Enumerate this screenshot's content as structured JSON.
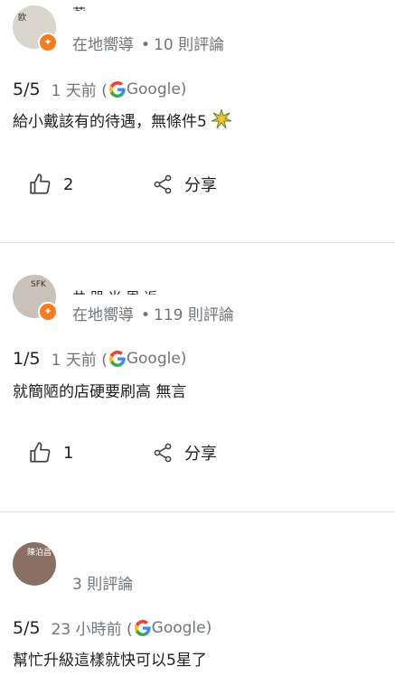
{
  "reviews": [
    {
      "avatar_text": "欧",
      "name": "莉",
      "meta": {
        "guide": "在地嚮導",
        "count": "10 則評論"
      },
      "rating": "5/5",
      "time": "1 天前 (",
      "source": "Google)",
      "text": "給小戴該有的待遇，無條件5",
      "emoji": "sparkle",
      "likes": "2",
      "share": "分享"
    },
    {
      "avatar_text": "SFK",
      "name": "井 咒 米 周 返",
      "meta": {
        "guide": "在地嚮導",
        "count": "119 則評論"
      },
      "rating": "1/5",
      "time": "1 天前 (",
      "source": "Google)",
      "text": "就簡陋的店硬要刷高 無言",
      "likes": "1",
      "share": "分享"
    },
    {
      "avatar_text": "陳泊昌",
      "meta": {
        "count": "3 則評論"
      },
      "rating": "5/5",
      "time": "23 小時前 (",
      "source": "Google)",
      "text": "幫忙升級這樣就快可以5星了"
    }
  ],
  "icons": {
    "like": "thumb-up-icon",
    "share": "share-icon",
    "google": "google-g-icon",
    "guide": "local-guide-star-icon"
  },
  "colors": {
    "guide_orange": "#f57c1f",
    "secondary_text": "#70757a",
    "divider": "#e0e0e0"
  }
}
